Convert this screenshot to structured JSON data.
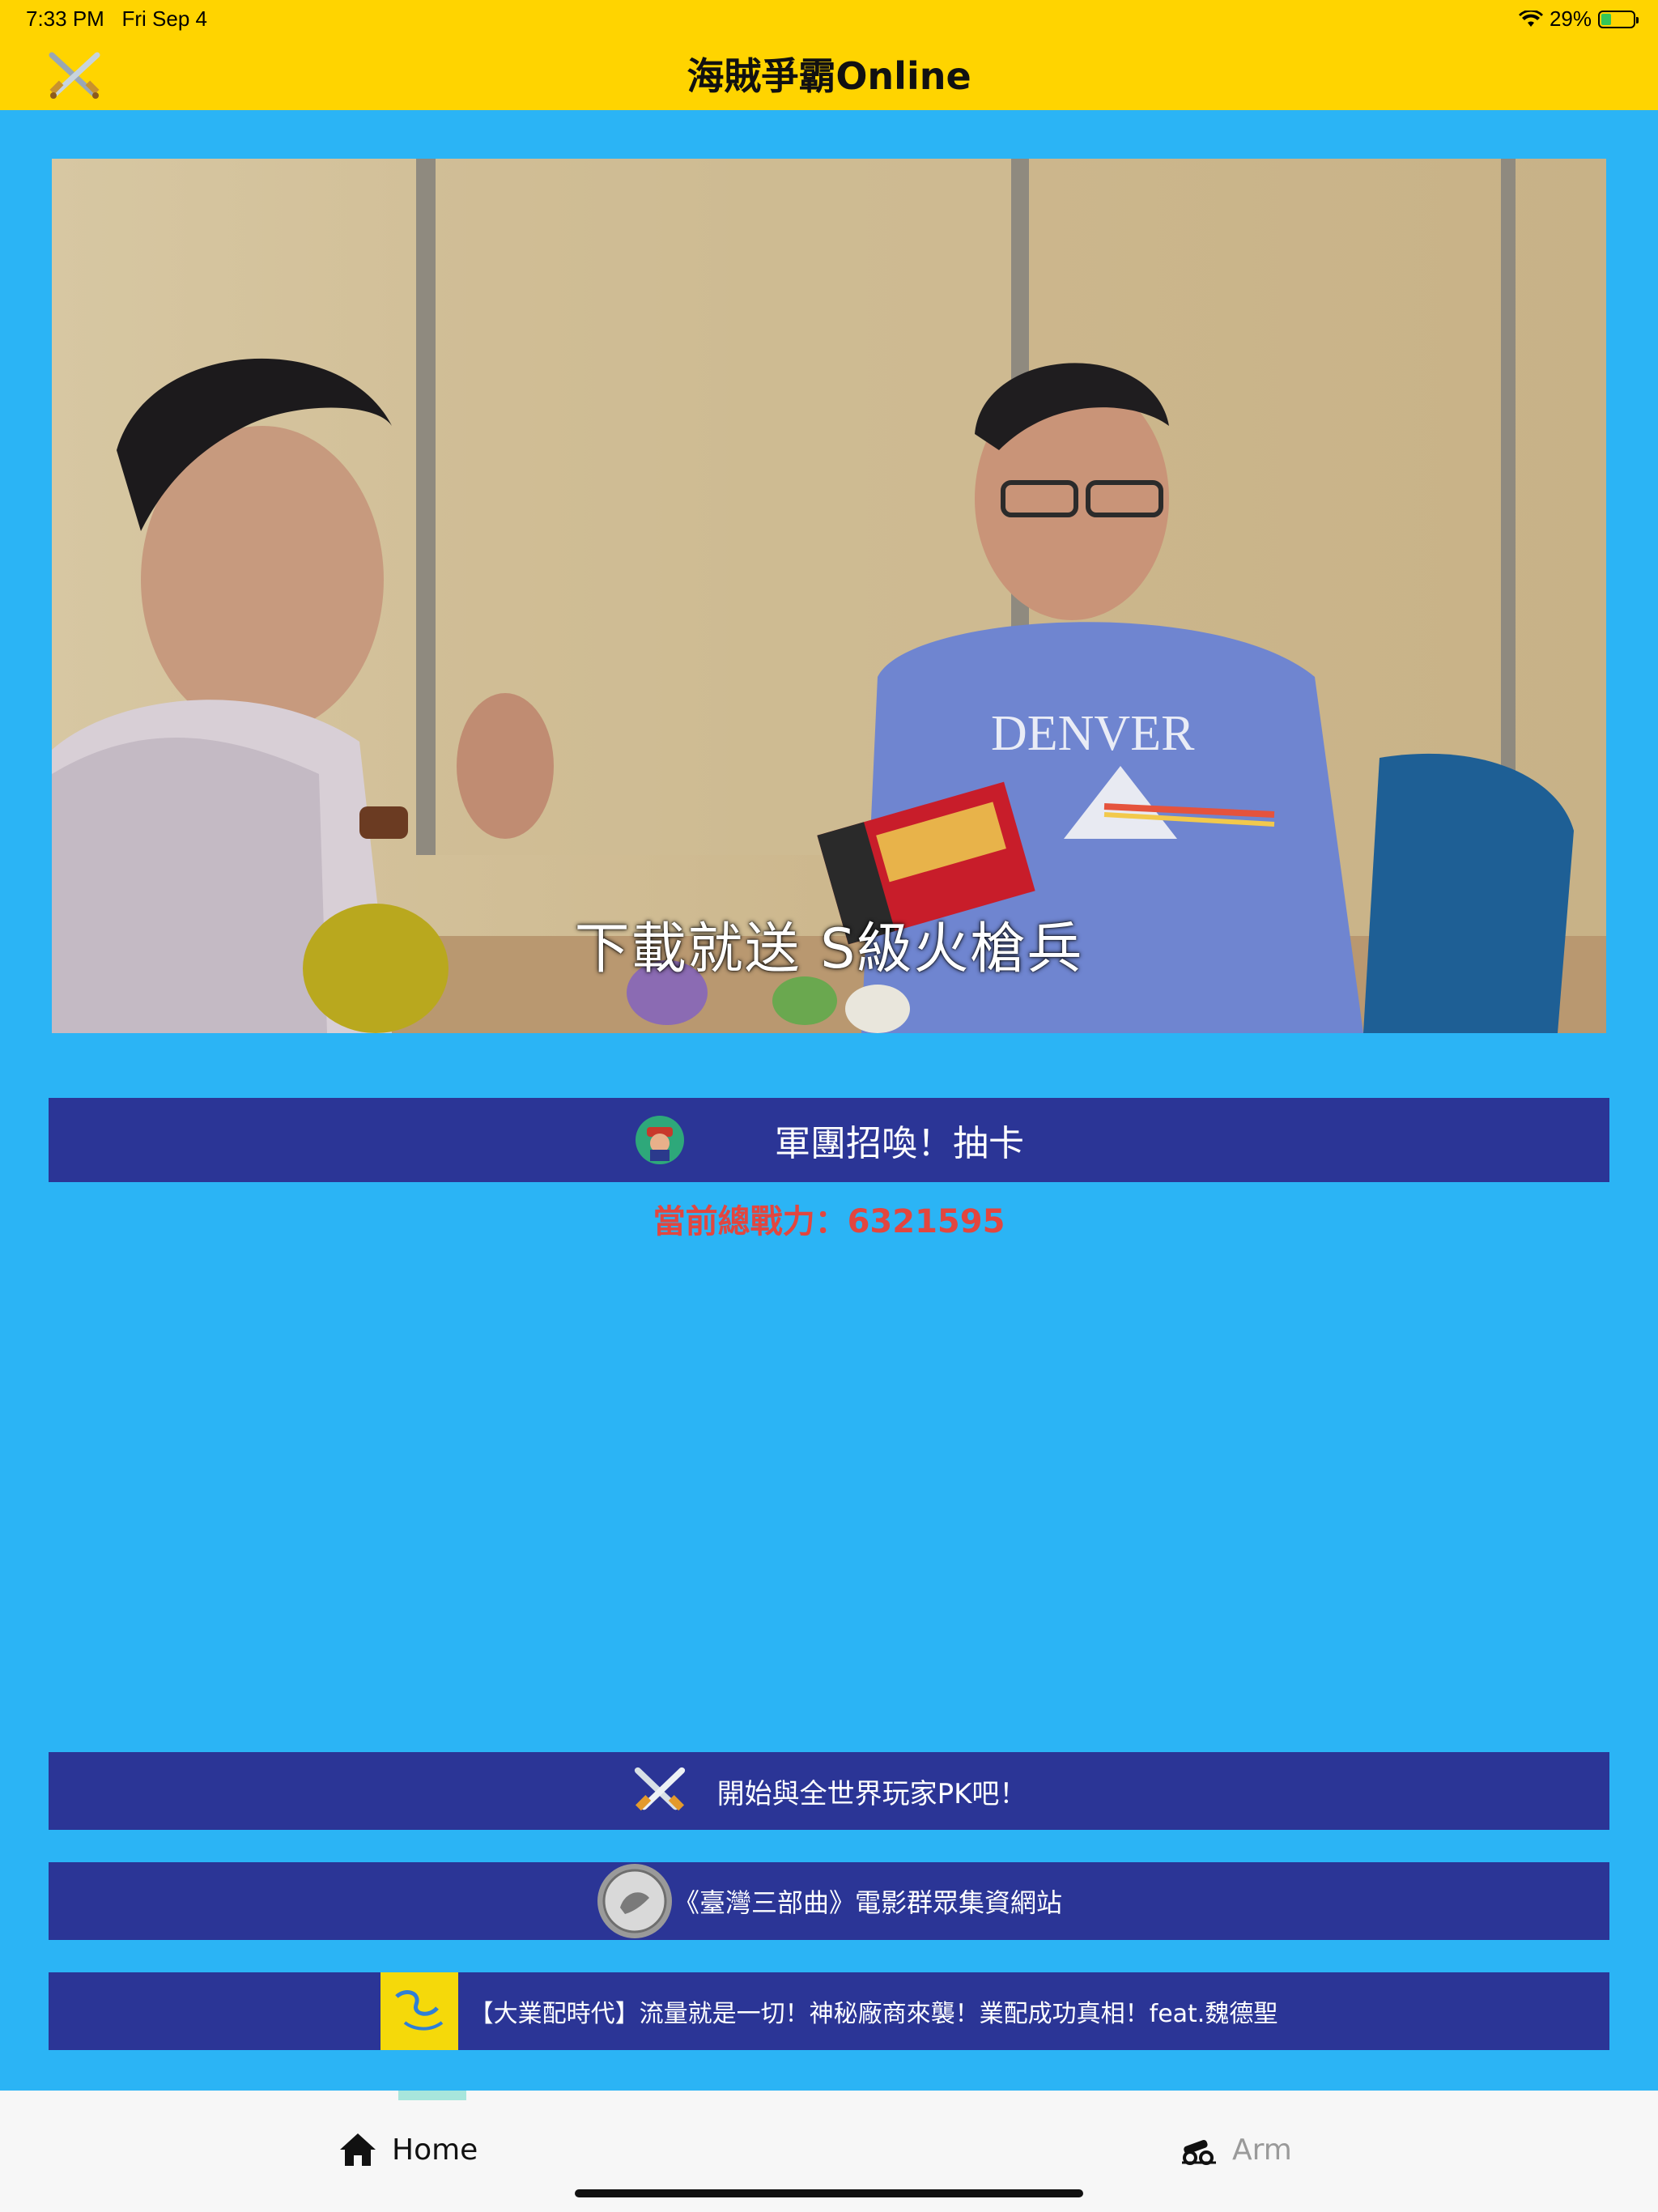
{
  "status_bar": {
    "time": "7:33 PM",
    "date": "Fri Sep 4",
    "battery_text": "29%"
  },
  "header": {
    "title": "海賊爭霸Online",
    "logo_icon": "crossed-swords-icon"
  },
  "video": {
    "caption": "下載就送 S級火槍兵",
    "shirt_text": "DENVER"
  },
  "buttons": {
    "summon": "軍團招喚！抽卡",
    "pk": "開始與全世界玩家PK吧！",
    "movie": "《臺灣三部曲》電影群眾集資網站",
    "ad": "【大業配時代】流量就是一切！神秘廠商來襲！業配成功真相！feat.魏德聖"
  },
  "power_text": "當前總戰力：6321595",
  "tabs": [
    {
      "label": "Home",
      "icon": "home-icon",
      "active": true
    },
    {
      "label": "Arm",
      "icon": "cannon-icon",
      "active": false
    }
  ],
  "colors": {
    "header_bg": "#FFD400",
    "page_bg": "#2BB4F5",
    "button_bg": "#2B3596",
    "power_text": "#E2463F"
  }
}
